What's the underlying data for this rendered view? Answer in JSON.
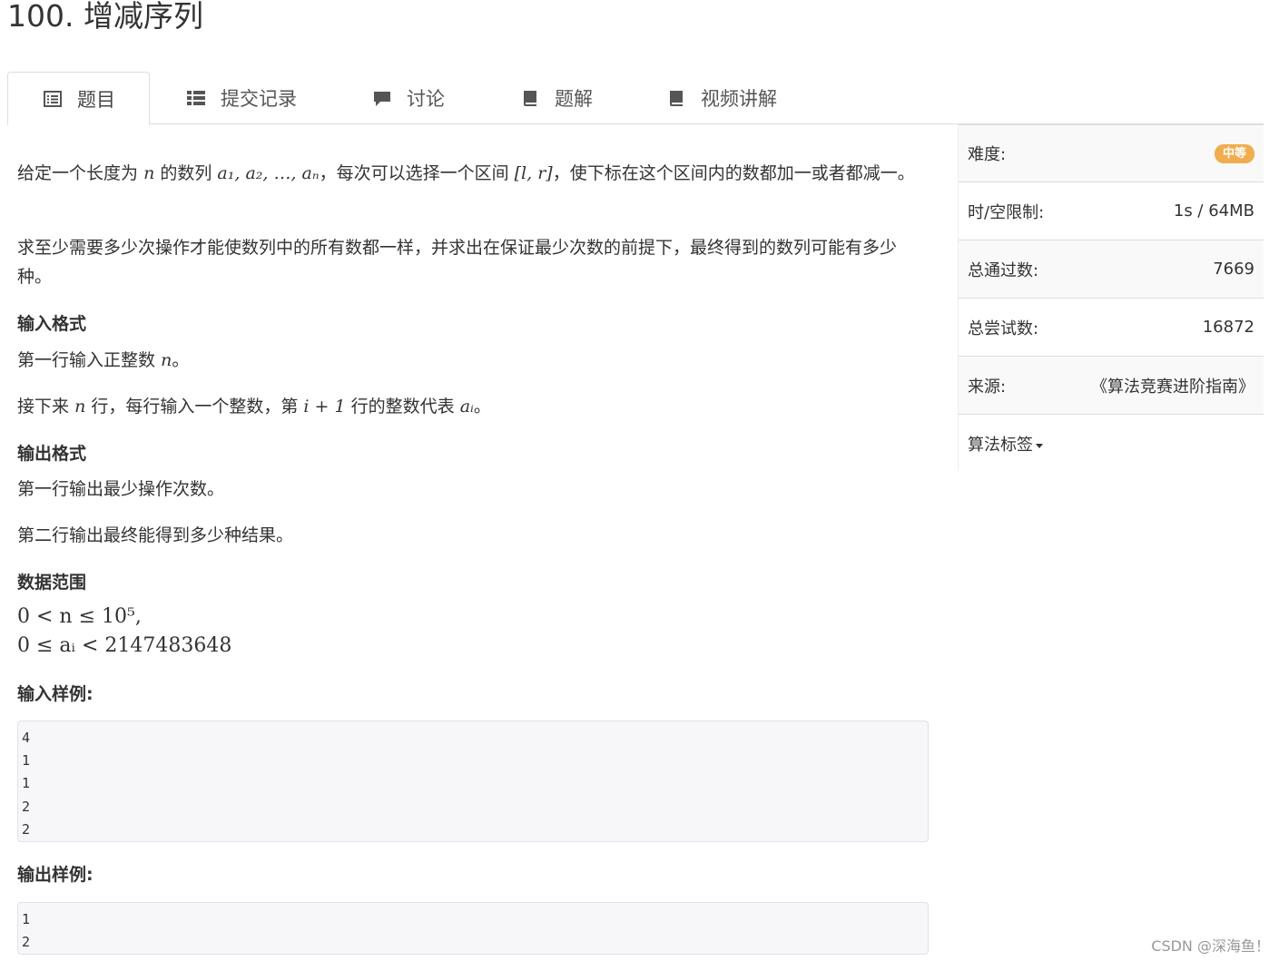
{
  "problem": {
    "title": "100. 增减序列"
  },
  "tabs": [
    {
      "label": "题目",
      "icon": "list-alt-icon",
      "active": true
    },
    {
      "label": "提交记录",
      "icon": "th-list-icon",
      "active": false
    },
    {
      "label": "讨论",
      "icon": "comment-icon",
      "active": false
    },
    {
      "label": "题解",
      "icon": "book-icon",
      "active": false
    },
    {
      "label": "视频讲解",
      "icon": "book-icon",
      "active": false
    }
  ],
  "description": {
    "p1_a": "给定一个长度为",
    "p1_n": "n",
    "p1_b": "的数列",
    "p1_seq": "a₁, a₂, …, aₙ",
    "p1_c": "，每次可以选择一个区间",
    "p1_interval": "[l, r]",
    "p1_d": "，使下标在这个区间内的数都加一或者都减一。",
    "p2": "求至少需要多少次操作才能使数列中的所有数都一样，并求出在保证最少次数的前提下，最终得到的数列可能有多少种。"
  },
  "input_format": {
    "heading": "输入格式",
    "line1_a": "第一行输入正整数",
    "line1_n": "n",
    "line1_b": "。",
    "line2_a": "接下来",
    "line2_n": "n",
    "line2_b": "行，每行输入一个整数，第",
    "line2_expr": "i + 1",
    "line2_c": "行的整数代表",
    "line2_ai": "aᵢ",
    "line2_d": "。"
  },
  "output_format": {
    "heading": "输出格式",
    "line1": "第一行输出最少操作次数。",
    "line2": "第二行输出最终能得到多少种结果。"
  },
  "data_range": {
    "heading": "数据范围",
    "line1": "0 < n ≤ 10⁵,",
    "line2": "0 ≤ aᵢ < 2147483648"
  },
  "sample_input": {
    "heading": "输入样例:",
    "content": "4\n1\n1\n2\n2"
  },
  "sample_output": {
    "heading": "输出样例:",
    "content": "1\n2"
  },
  "sidebar": {
    "difficulty_label": "难度:",
    "difficulty_value": "中等",
    "limit_label": "时/空限制:",
    "limit_value": "1s / 64MB",
    "passed_label": "总通过数:",
    "passed_value": "7669",
    "tried_label": "总尝试数:",
    "tried_value": "16872",
    "source_label": "来源:",
    "source_value": "《算法竞赛进阶指南》",
    "tags_label": "算法标签"
  },
  "colors": {
    "badge": "#f0ad4e",
    "border": "#dddddd",
    "code_bg": "#f7f7f9"
  },
  "watermark": "CSDN @深海鱼！"
}
